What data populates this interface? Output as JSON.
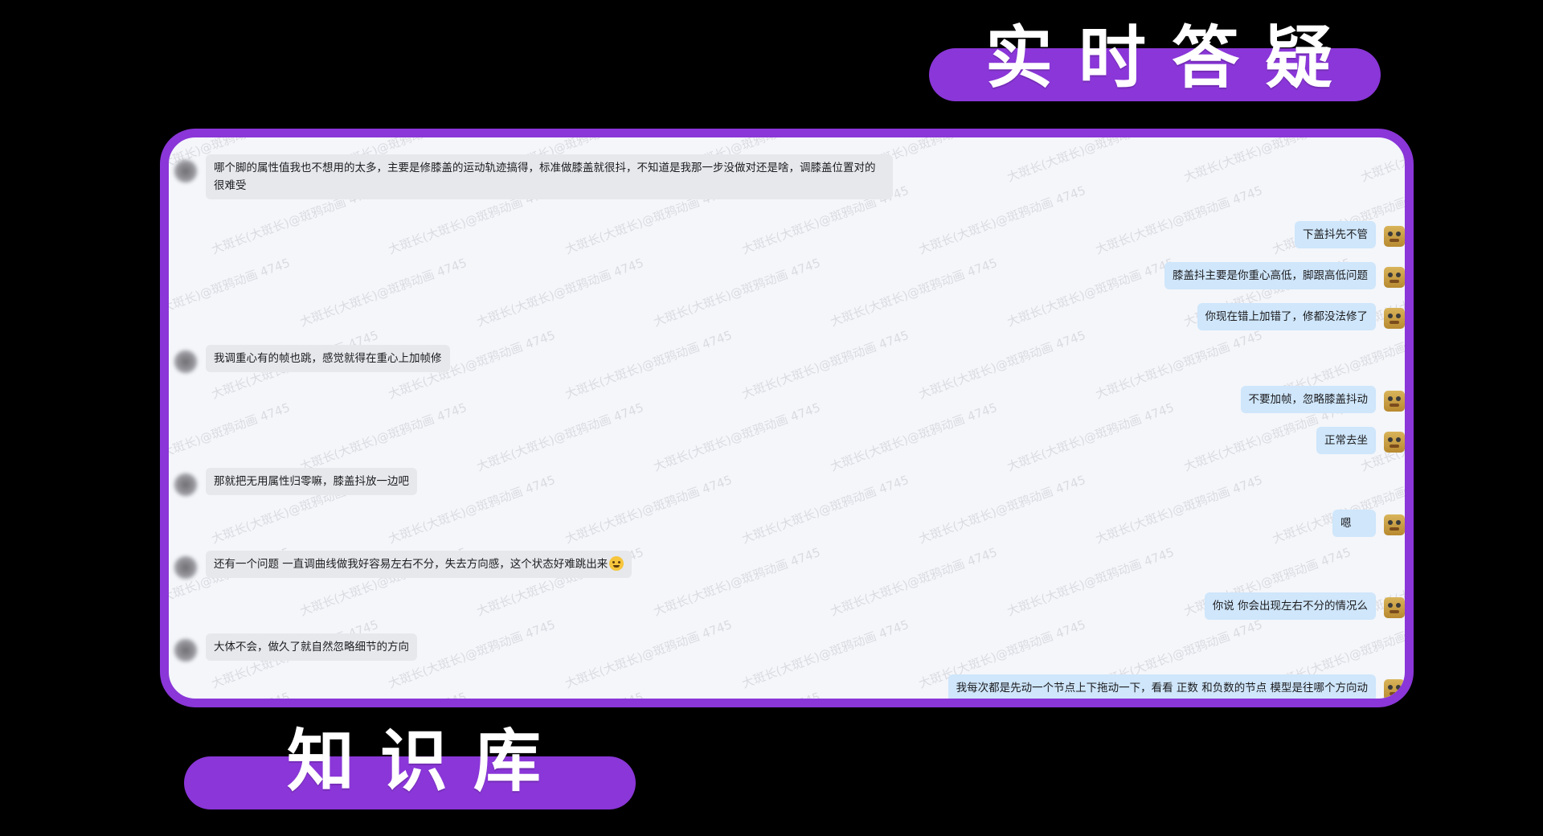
{
  "titles": {
    "top": "实时答疑",
    "bottom": "知识库"
  },
  "colors": {
    "background": "#000000",
    "accent_purple": "#8a36d8",
    "chat_background": "#f4f6fa",
    "left_bubble": "#e6e8ec",
    "right_bubble": "#cfe6fb"
  },
  "watermark": "大斑长(大斑长)@斑鸦动画 4745",
  "messages": [
    {
      "side": "left",
      "text": "哪个脚的属性值我也不想用的太多，主要是修膝盖的运动轨迹搞得，标准做膝盖就很抖，不知道是我那一步没做对还是啥，调膝盖位置对的很难受"
    },
    {
      "side": "right",
      "text": "下盖抖先不管"
    },
    {
      "side": "right",
      "text": "膝盖抖主要是你重心高低，脚跟高低问题"
    },
    {
      "side": "right",
      "text": "你现在错上加错了，修都没法修了"
    },
    {
      "side": "left",
      "text": "我调重心有的帧也跳，感觉就得在重心上加帧修"
    },
    {
      "side": "right",
      "text": "不要加帧，忽略膝盖抖动"
    },
    {
      "side": "right",
      "text": "正常去坐"
    },
    {
      "side": "left",
      "text": "那就把无用属性归零嘛，膝盖抖放一边吧"
    },
    {
      "side": "right",
      "text": "嗯"
    },
    {
      "side": "left",
      "text": "还有一个问题  一直调曲线做我好容易左右不分，失去方向感，这个状态好难跳出来",
      "emoji": "smiling-face"
    },
    {
      "side": "right",
      "text": "你说 你会出现左右不分的情况么"
    },
    {
      "side": "left",
      "text": "大体不会，做久了就自然忽略细节的方向"
    },
    {
      "side": "right",
      "text": "我每次都是先动一个节点上下拖动一下，看看 正数 和负数的节点 模型是往哪个方向动"
    }
  ]
}
